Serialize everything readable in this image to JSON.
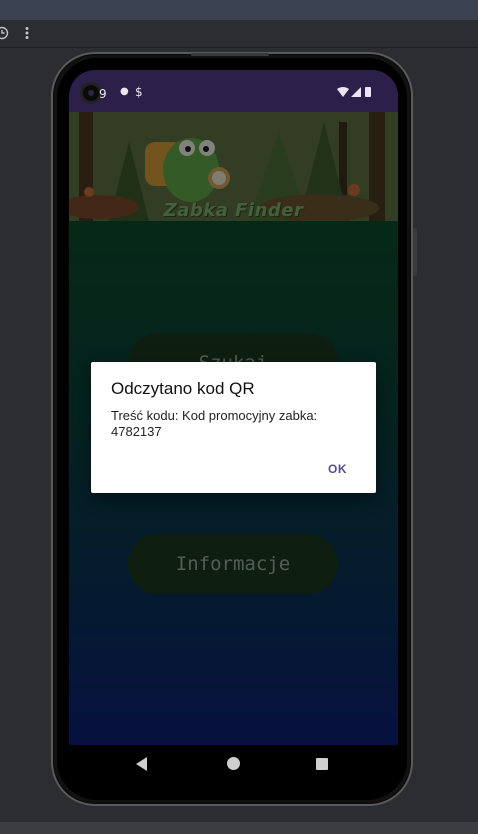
{
  "emulator": {
    "toolbar_icons": [
      "timer-icon",
      "more-vert-icon"
    ]
  },
  "status_bar": {
    "time": "9",
    "left_icons": [
      "notification-dot-icon",
      "dollar-icon"
    ],
    "right_icons": [
      "wifi-icon",
      "signal-icon",
      "battery-icon"
    ]
  },
  "banner": {
    "title": "Zabka Finder"
  },
  "main": {
    "buttons": [
      {
        "label": "Szukaj"
      },
      {
        "label": "Informacje"
      }
    ]
  },
  "dialog": {
    "title": "Odczytano kod QR",
    "message": "Treść kodu: Kod promocyjny zabka: 4782137",
    "ok_label": "OK"
  },
  "nav_bar": {
    "buttons": [
      "back",
      "home",
      "recent-apps"
    ]
  },
  "colors": {
    "status_bar": "#2c1f4a",
    "dialog_accent": "#5a4b8a",
    "button_bg": "#1b3a22"
  }
}
